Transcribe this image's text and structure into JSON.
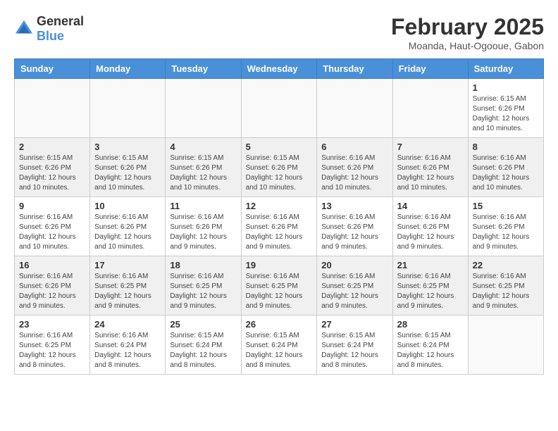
{
  "header": {
    "logo": {
      "general": "General",
      "blue": "Blue"
    },
    "title": "February 2025",
    "subtitle": "Moanda, Haut-Ogooue, Gabon"
  },
  "calendar": {
    "days_of_week": [
      "Sunday",
      "Monday",
      "Tuesday",
      "Wednesday",
      "Thursday",
      "Friday",
      "Saturday"
    ],
    "weeks": [
      {
        "shaded": false,
        "days": [
          {
            "num": "",
            "info": ""
          },
          {
            "num": "",
            "info": ""
          },
          {
            "num": "",
            "info": ""
          },
          {
            "num": "",
            "info": ""
          },
          {
            "num": "",
            "info": ""
          },
          {
            "num": "",
            "info": ""
          },
          {
            "num": "1",
            "info": "Sunrise: 6:15 AM\nSunset: 6:26 PM\nDaylight: 12 hours\nand 10 minutes."
          }
        ]
      },
      {
        "shaded": true,
        "days": [
          {
            "num": "2",
            "info": "Sunrise: 6:15 AM\nSunset: 6:26 PM\nDaylight: 12 hours\nand 10 minutes."
          },
          {
            "num": "3",
            "info": "Sunrise: 6:15 AM\nSunset: 6:26 PM\nDaylight: 12 hours\nand 10 minutes."
          },
          {
            "num": "4",
            "info": "Sunrise: 6:15 AM\nSunset: 6:26 PM\nDaylight: 12 hours\nand 10 minutes."
          },
          {
            "num": "5",
            "info": "Sunrise: 6:15 AM\nSunset: 6:26 PM\nDaylight: 12 hours\nand 10 minutes."
          },
          {
            "num": "6",
            "info": "Sunrise: 6:16 AM\nSunset: 6:26 PM\nDaylight: 12 hours\nand 10 minutes."
          },
          {
            "num": "7",
            "info": "Sunrise: 6:16 AM\nSunset: 6:26 PM\nDaylight: 12 hours\nand 10 minutes."
          },
          {
            "num": "8",
            "info": "Sunrise: 6:16 AM\nSunset: 6:26 PM\nDaylight: 12 hours\nand 10 minutes."
          }
        ]
      },
      {
        "shaded": false,
        "days": [
          {
            "num": "9",
            "info": "Sunrise: 6:16 AM\nSunset: 6:26 PM\nDaylight: 12 hours\nand 10 minutes."
          },
          {
            "num": "10",
            "info": "Sunrise: 6:16 AM\nSunset: 6:26 PM\nDaylight: 12 hours\nand 10 minutes."
          },
          {
            "num": "11",
            "info": "Sunrise: 6:16 AM\nSunset: 6:26 PM\nDaylight: 12 hours\nand 9 minutes."
          },
          {
            "num": "12",
            "info": "Sunrise: 6:16 AM\nSunset: 6:26 PM\nDaylight: 12 hours\nand 9 minutes."
          },
          {
            "num": "13",
            "info": "Sunrise: 6:16 AM\nSunset: 6:26 PM\nDaylight: 12 hours\nand 9 minutes."
          },
          {
            "num": "14",
            "info": "Sunrise: 6:16 AM\nSunset: 6:26 PM\nDaylight: 12 hours\nand 9 minutes."
          },
          {
            "num": "15",
            "info": "Sunrise: 6:16 AM\nSunset: 6:26 PM\nDaylight: 12 hours\nand 9 minutes."
          }
        ]
      },
      {
        "shaded": true,
        "days": [
          {
            "num": "16",
            "info": "Sunrise: 6:16 AM\nSunset: 6:26 PM\nDaylight: 12 hours\nand 9 minutes."
          },
          {
            "num": "17",
            "info": "Sunrise: 6:16 AM\nSunset: 6:25 PM\nDaylight: 12 hours\nand 9 minutes."
          },
          {
            "num": "18",
            "info": "Sunrise: 6:16 AM\nSunset: 6:25 PM\nDaylight: 12 hours\nand 9 minutes."
          },
          {
            "num": "19",
            "info": "Sunrise: 6:16 AM\nSunset: 6:25 PM\nDaylight: 12 hours\nand 9 minutes."
          },
          {
            "num": "20",
            "info": "Sunrise: 6:16 AM\nSunset: 6:25 PM\nDaylight: 12 hours\nand 9 minutes."
          },
          {
            "num": "21",
            "info": "Sunrise: 6:16 AM\nSunset: 6:25 PM\nDaylight: 12 hours\nand 9 minutes."
          },
          {
            "num": "22",
            "info": "Sunrise: 6:16 AM\nSunset: 6:25 PM\nDaylight: 12 hours\nand 9 minutes."
          }
        ]
      },
      {
        "shaded": false,
        "days": [
          {
            "num": "23",
            "info": "Sunrise: 6:16 AM\nSunset: 6:25 PM\nDaylight: 12 hours\nand 8 minutes."
          },
          {
            "num": "24",
            "info": "Sunrise: 6:16 AM\nSunset: 6:24 PM\nDaylight: 12 hours\nand 8 minutes."
          },
          {
            "num": "25",
            "info": "Sunrise: 6:15 AM\nSunset: 6:24 PM\nDaylight: 12 hours\nand 8 minutes."
          },
          {
            "num": "26",
            "info": "Sunrise: 6:15 AM\nSunset: 6:24 PM\nDaylight: 12 hours\nand 8 minutes."
          },
          {
            "num": "27",
            "info": "Sunrise: 6:15 AM\nSunset: 6:24 PM\nDaylight: 12 hours\nand 8 minutes."
          },
          {
            "num": "28",
            "info": "Sunrise: 6:15 AM\nSunset: 6:24 PM\nDaylight: 12 hours\nand 8 minutes."
          },
          {
            "num": "",
            "info": ""
          }
        ]
      }
    ]
  }
}
